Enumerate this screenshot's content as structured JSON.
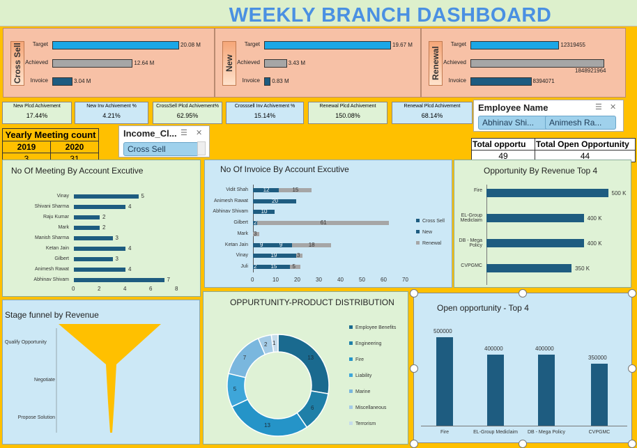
{
  "title": "WEEKLY BRANCH DASHBOARD",
  "kpi_panels": [
    {
      "tab": "Cross Sell",
      "rows": [
        {
          "label": "Target",
          "value": "20.08 M",
          "fill": 1.0,
          "color": "#1BA7E6"
        },
        {
          "label": "Achieved",
          "value": "12.64 M",
          "fill": 0.63,
          "color": "#A6A6A6"
        },
        {
          "label": "Invoice",
          "value": "3.04 M",
          "fill": 0.15,
          "color": "#1E5C80"
        }
      ]
    },
    {
      "tab": "New",
      "rows": [
        {
          "label": "Target",
          "value": "19.67 M",
          "fill": 1.0,
          "color": "#1BA7E6"
        },
        {
          "label": "Achieved",
          "value": "3.43 M",
          "fill": 0.17,
          "color": "#A6A6A6"
        },
        {
          "label": "Invoice",
          "value": "0.83 M",
          "fill": 0.04,
          "color": "#1E5C80"
        }
      ]
    },
    {
      "tab": "Renewal",
      "rows": [
        {
          "label": "Target",
          "value": "12319455",
          "fill": 0.66,
          "color": "#1BA7E6"
        },
        {
          "label": "Achieved",
          "value": "1848921964",
          "fill": 1.0,
          "color": "#A6A6A6"
        },
        {
          "label": "Invoice",
          "value": "8394071",
          "fill": 0.45,
          "color": "#1E5C80"
        }
      ]
    }
  ],
  "mini_kpis": [
    {
      "label": "New Plcd Achivement",
      "value": "17.44%"
    },
    {
      "label": "New Inv Achivement %",
      "value": "4.21%"
    },
    {
      "label": "CrossSell Plcd Achivement%",
      "value": "62.95%"
    },
    {
      "label": "Crosssell Inv Achivement %",
      "value": "15.14%"
    },
    {
      "label": "Renewal Plcd Achivement",
      "value": "150.08%"
    },
    {
      "label": "Renewal Plcd Achivement",
      "value": "68.14%"
    }
  ],
  "employee_slicer": {
    "title": "Employee Name",
    "items": [
      "Abhinav Shi...",
      "Animesh Ra..."
    ]
  },
  "income_slicer": {
    "title": "Income_Cl...",
    "items": [
      "Cross Sell"
    ]
  },
  "yearly_meeting": {
    "title": "Yearly Meeting count",
    "years": [
      "2019",
      "2020"
    ],
    "counts": [
      "3",
      "31"
    ]
  },
  "totals": [
    {
      "label": "Total opportu",
      "value": "49"
    },
    {
      "label": "Total Open Opportunity",
      "value": "44"
    }
  ],
  "chart_data": [
    {
      "type": "bar",
      "title": "No Of Meeting By Account Excutive",
      "categories": [
        "Vinay",
        "Shivani Sharma",
        "Raju Kumar",
        "Mark",
        "Manish Sharma",
        "Ketan Jain",
        "Gilbert",
        "Animesh Rawat",
        "Abhinav Shivam"
      ],
      "values": [
        5,
        4,
        2,
        2,
        3,
        4,
        3,
        4,
        7
      ],
      "xlim": [
        0,
        8
      ],
      "xticks": [
        "0",
        "2",
        "4",
        "6",
        "8"
      ]
    },
    {
      "type": "bar",
      "title": "No Of Invoice By Account Excutive",
      "categories": [
        "Vidit Shah",
        "Animesh Rawat",
        "Abhinav Shivam",
        "Gilbert",
        "Mark",
        "Ketan Jain",
        "Vinay",
        "Juli"
      ],
      "series": [
        {
          "name": "Cross Sell",
          "values": [
            12,
            20,
            10,
            2,
            null,
            9,
            19,
            2
          ],
          "labels": [
            "12",
            "20",
            "10",
            "2",
            "",
            "9",
            "19",
            "2"
          ]
        },
        {
          "name": "New",
          "values": [
            null,
            null,
            null,
            null,
            null,
            9,
            1,
            15
          ],
          "labels": [
            "",
            "",
            "",
            "",
            "",
            "9",
            "",
            "15"
          ]
        },
        {
          "name": "Renewal",
          "values": [
            15,
            null,
            null,
            61,
            3,
            18,
            3,
            5
          ],
          "labels": [
            "15",
            "",
            "",
            "61",
            "3",
            "18",
            "3",
            "5"
          ]
        }
      ],
      "xlim": [
        0,
        70
      ],
      "xticks": [
        "0",
        "10",
        "20",
        "30",
        "40",
        "50",
        "60",
        "70"
      ],
      "colors": [
        "#1E5C80",
        "#1E5C80",
        "#A6A6A6"
      ]
    },
    {
      "type": "bar",
      "title": "Opportunity By Revenue Top 4",
      "categories": [
        "Fire",
        "EL-Group Mediclaim",
        "DB - Mega Policy",
        "CVPGMC"
      ],
      "values": [
        500000,
        400000,
        400000,
        350000
      ],
      "labels": [
        "500 K",
        "400 K",
        "400 K",
        "350 K"
      ],
      "xlim": [
        0,
        550000
      ]
    },
    {
      "type": "funnel",
      "title": "Stage funnel by Revenue",
      "categories": [
        "Qualify Opportunity",
        "Negotiate",
        "Propose Solution"
      ]
    },
    {
      "type": "pie",
      "title": "OPPURTUNITY-PRODUCT DISTRIBUTION",
      "categories": [
        "Employee Benefits",
        "Engineering",
        "Fire",
        "Liability",
        "Marine",
        "Miscellaneous",
        "Terrorism"
      ],
      "values": [
        13,
        6,
        13,
        5,
        7,
        2,
        1
      ],
      "colors": [
        "#1A6A8F",
        "#1F7FA8",
        "#2594C8",
        "#3EA6D9",
        "#7AB7DE",
        "#A4CBE6",
        "#C6DCEB"
      ]
    },
    {
      "type": "bar",
      "title": "Open opportunity - Top 4",
      "categories": [
        "Fire",
        "EL-Group Mediclaim",
        "DB - Mega Policy",
        "CVPGMC"
      ],
      "tick_labels": [
        "Fire",
        "EL-Group Mediclaim",
        "DB - Mega Policy",
        "CVPGMC"
      ],
      "values": [
        500000,
        400000,
        400000,
        350000
      ],
      "labels": [
        "500000",
        "400000",
        "400000",
        "350000"
      ],
      "ylim": [
        0,
        550000
      ]
    }
  ]
}
